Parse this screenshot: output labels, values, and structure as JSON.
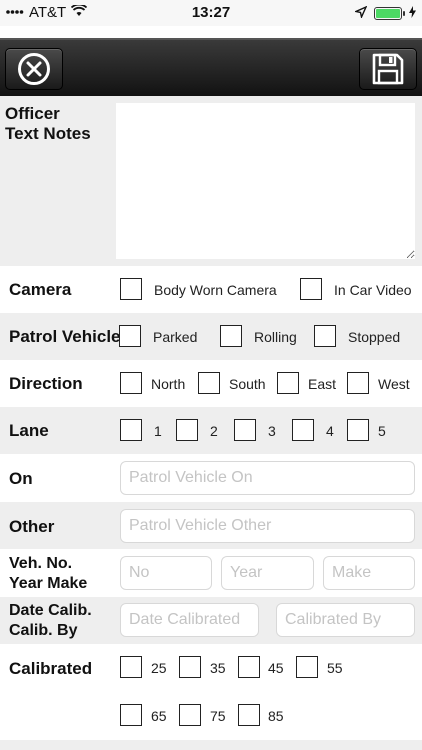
{
  "status_bar": {
    "carrier": "AT&T",
    "time": "13:27"
  },
  "toolbar": {
    "close_icon": "close-circle-icon",
    "save_icon": "floppy-disk-icon"
  },
  "notes": {
    "label": "Officer\nText Notes",
    "value": ""
  },
  "camera": {
    "label": "Camera",
    "options": [
      "Body Worn Camera",
      "In Car Video"
    ]
  },
  "patrol_vehicle": {
    "label": "Patrol Vehicle",
    "options": [
      "Parked",
      "Rolling",
      "Stopped"
    ]
  },
  "direction": {
    "label": "Direction",
    "options": [
      "North",
      "South",
      "East",
      "West"
    ]
  },
  "lane": {
    "label": "Lane",
    "options": [
      "1",
      "2",
      "3",
      "4",
      "5"
    ]
  },
  "on": {
    "label": "On",
    "placeholder": "Patrol Vehicle On"
  },
  "other": {
    "label": "Other",
    "placeholder": "Patrol Vehicle Other"
  },
  "vehicle": {
    "label": "Veh. No.\nYear Make",
    "placeholders": [
      "No",
      "Year",
      "Make"
    ]
  },
  "calibration": {
    "label": "Date Calib.\nCalib. By",
    "placeholders": [
      "Date Calibrated",
      "Calibrated By"
    ]
  },
  "calibrated": {
    "label": "Calibrated",
    "options": [
      "25",
      "35",
      "45",
      "55",
      "65",
      "75",
      "85"
    ]
  }
}
